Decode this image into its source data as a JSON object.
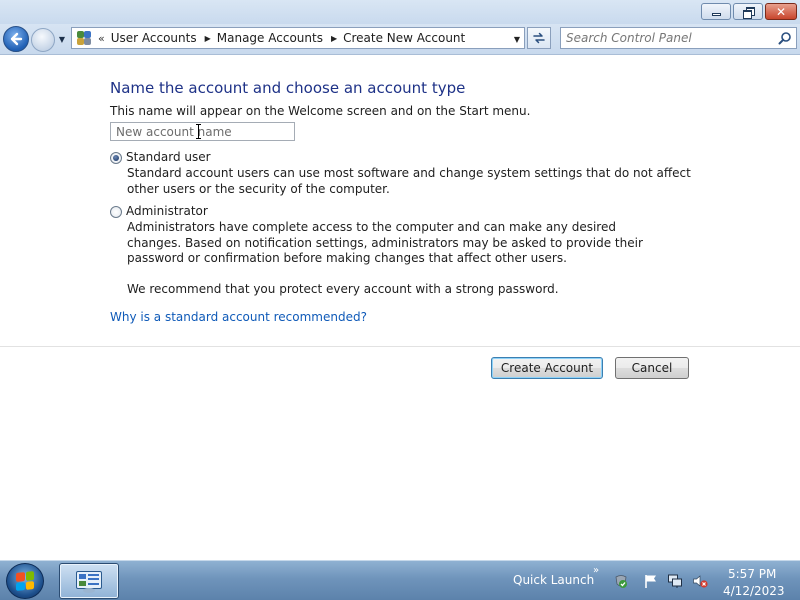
{
  "window": {
    "minimize_icon": "minimize-icon",
    "maximize_icon": "restore-icon",
    "close_icon": "close-icon"
  },
  "navigation": {
    "back_icon": "back-arrow-icon",
    "forward_icon": "forward-arrow-icon",
    "breadcrumb": [
      "User Accounts",
      "Manage Accounts",
      "Create New Account"
    ],
    "search_placeholder": "Search Control Panel"
  },
  "form": {
    "heading": "Name the account and choose an account type",
    "name_hint": "This name will appear on the Welcome screen and on the Start menu.",
    "name_placeholder": "New account name",
    "name_value": "",
    "options": [
      {
        "label": "Standard user",
        "description": "Standard account users can use most software and change system settings that do not affect other users or the security of the computer.",
        "selected": true
      },
      {
        "label": "Administrator",
        "description": "Administrators have complete access to the computer and can make any desired changes. Based on notification settings, administrators may be asked to provide their password or confirmation before making changes that affect other users.",
        "selected": false
      }
    ],
    "recommendation": "We recommend that you protect every account with a strong password.",
    "help_link": "Why is a standard account recommended?",
    "create_button": "Create Account",
    "cancel_button": "Cancel"
  },
  "taskbar": {
    "quick_launch": "Quick Launch",
    "clock_time": "5:57 PM",
    "clock_date": "4/12/2023"
  },
  "colors": {
    "heading": "#1e3287",
    "link": "#0f5ab8",
    "taskbar": "#6f94bb"
  }
}
